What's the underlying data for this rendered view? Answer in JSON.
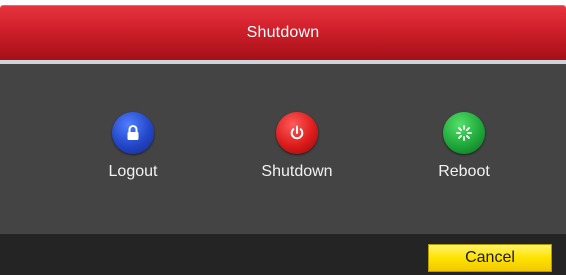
{
  "dialog": {
    "title": "Shutdown"
  },
  "actions": [
    {
      "id": "logout",
      "label": "Logout",
      "icon": "lock-icon",
      "color": "#2346c8"
    },
    {
      "id": "shutdown",
      "label": "Shutdown",
      "icon": "power-icon",
      "color": "#dd1b1b"
    },
    {
      "id": "reboot",
      "label": "Reboot",
      "icon": "reboot-icon",
      "color": "#1fa83a"
    }
  ],
  "footer": {
    "cancel_label": "Cancel"
  },
  "colors": {
    "titlebar": "#cf1f2a",
    "content_bg": "#444444",
    "footer_bg": "#242424",
    "cancel_bg": "#ffe200"
  }
}
